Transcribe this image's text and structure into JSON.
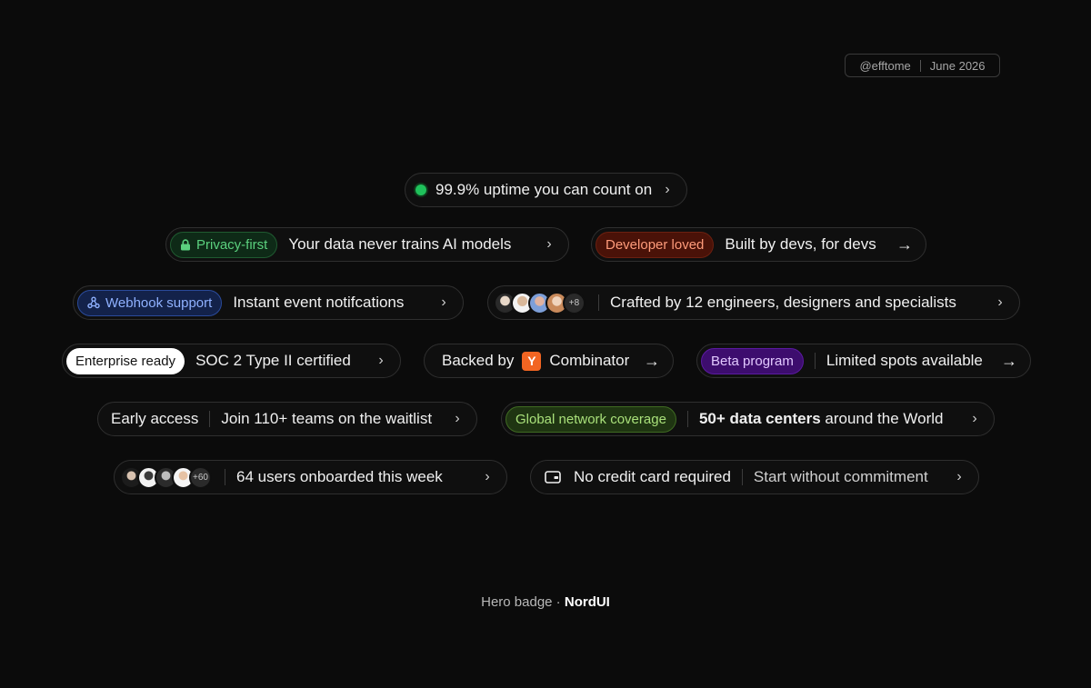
{
  "meta": {
    "handle": "@efftome",
    "date": "June 2026"
  },
  "badges": {
    "uptime": {
      "text": "99.9% uptime you can count on"
    },
    "privacy": {
      "pill": "Privacy-first",
      "text": "Your data never trains AI models"
    },
    "developer": {
      "pill": "Developer loved",
      "text": "Built by devs, for devs"
    },
    "webhook": {
      "pill": "Webhook support",
      "text": "Instant event notifcations"
    },
    "crafted": {
      "more": "+8",
      "text": "Crafted by 12 engineers, designers and specialists"
    },
    "enterprise": {
      "pill": "Enterprise ready",
      "text": "SOC 2 Type II certified"
    },
    "backed": {
      "prefix": "Backed by",
      "logo": "Y",
      "suffix": "Combinator"
    },
    "beta": {
      "pill": "Beta program",
      "text": "Limited spots available"
    },
    "early": {
      "label": "Early access",
      "text": "Join 110+ teams on the waitlist"
    },
    "global": {
      "pill": "Global network coverage",
      "text_bold": "50+ data centers",
      "text_rest": " around the World"
    },
    "users": {
      "more": "+60",
      "text": "64 users onboarded this week"
    },
    "credit": {
      "label": "No credit card required",
      "text": "Start without commitment"
    }
  },
  "icons": {
    "chevron": "›",
    "arrow": "→",
    "lock": "lock-icon",
    "webhook": "webhook-icon",
    "card": "credit-card-icon"
  },
  "colors": {
    "green": "#1fc15b",
    "yc_orange": "#f26522",
    "privacy_bg": "#0e2a17",
    "developer_bg": "#4a1208",
    "webhook_bg": "#13224a",
    "beta_bg": "#3d0d6e",
    "global_bg": "#1f3512"
  },
  "footer": {
    "label": "Hero badge · ",
    "brand": "NordUI"
  }
}
